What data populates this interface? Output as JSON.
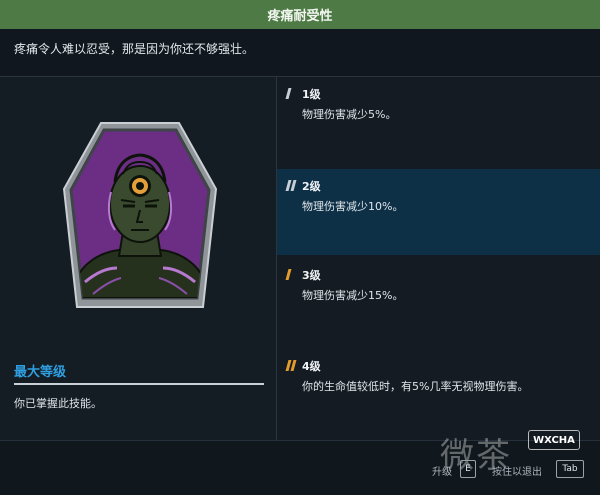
{
  "skill": {
    "title": "疼痛耐受性",
    "description": "疼痛令人难以忍受，那是因为你还不够强壮。"
  },
  "max_level": {
    "title": "最大等级",
    "description": "你已掌握此技能。"
  },
  "levels": [
    {
      "name": "1级",
      "text": "物理伤害减少5%。"
    },
    {
      "name": "2级",
      "text": "物理伤害减少10%。"
    },
    {
      "name": "3级",
      "text": "物理伤害减少15%。"
    },
    {
      "name": "4级",
      "text": "你的生命值较低时，有5%几率无视物理伤害。"
    }
  ],
  "footer": {
    "upgrade_label": "升级",
    "upgrade_key": "E",
    "exit_label": "按住以退出",
    "exit_key": "Tab"
  },
  "watermark": {
    "text": "微茶",
    "badge": "WXCHA"
  },
  "icons": {
    "badge": "cybernetic-head-badge-icon",
    "level_marker": "level-marker-icon"
  },
  "colors": {
    "title_bar": "#4d7a45",
    "accent_blue": "#2f9fe0",
    "active_row": "#0e3047",
    "marker_gray": "#c8ced4",
    "marker_orange": "#e39b2b",
    "badge_purple": "#6b2e84"
  }
}
